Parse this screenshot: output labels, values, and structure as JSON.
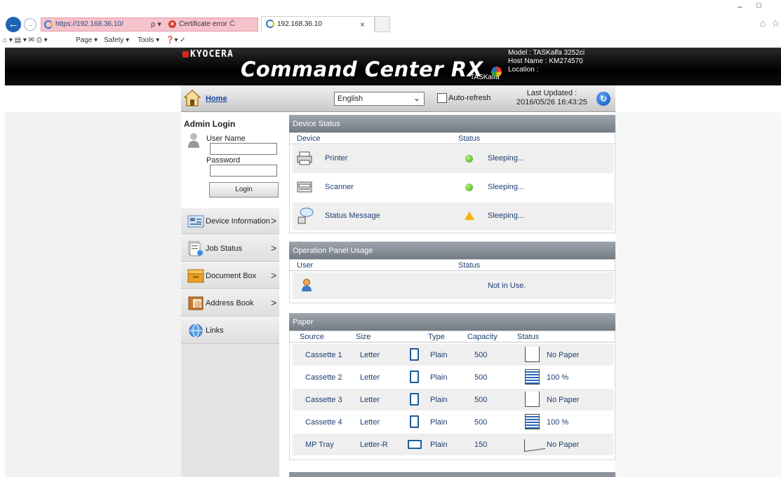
{
  "browser": {
    "url": "https://192.168.36.10/",
    "search_glyph": "ρ ▾",
    "cert_error": "Certificate error",
    "refresh_glyph": "Ċ",
    "tab_title": "192.168.36.10",
    "tab_close": "×",
    "window_min": "–",
    "window_max": "□",
    "home_glyph": "⌂",
    "fav_glyph": "☆",
    "back_glyph": "←",
    "fwd_glyph": "→",
    "cmdbar": {
      "page": "Page ▾",
      "safety": "Safety ▾",
      "tools": "Tools ▾",
      "icons_left": "⌂ ▾  ▤ ▾ ✉  ⎙ ▾",
      "help": "❓▾  ✓"
    }
  },
  "header": {
    "brand": "KYOCERA",
    "product": "Command Center RX",
    "series": "TASKalfa",
    "model": "Model : TASKalfa 3252ci",
    "host": "Host Name : KM274570",
    "location": "Location :"
  },
  "navbar": {
    "home_label": "Home",
    "language": "English",
    "caret": "⌄",
    "auto_refresh": "Auto-refresh",
    "last_updated_label": "Last Updated :",
    "last_updated_value": "2016/05/26 16:43:25"
  },
  "sidebar": {
    "login_title": "Admin Login",
    "user_label": "User Name",
    "password_label": "Password",
    "login_button": "Login",
    "chev": ">",
    "items": [
      {
        "label": "Device Information",
        "icon": "device-info-icon"
      },
      {
        "label": "Job Status",
        "icon": "job-status-icon"
      },
      {
        "label": "Document Box",
        "icon": "document-box-icon"
      },
      {
        "label": "Address Book",
        "icon": "address-book-icon"
      },
      {
        "label": "Links",
        "icon": "links-icon"
      }
    ]
  },
  "device_status": {
    "title": "Device Status",
    "col_device": "Device",
    "col_status": "Status",
    "rows": [
      {
        "name": "Printer",
        "status": "Sleeping..."
      },
      {
        "name": "Scanner",
        "status": "Sleeping..."
      },
      {
        "name": "Status Message",
        "status": "Sleeping..."
      }
    ]
  },
  "panel_usage": {
    "title": "Operation Panel Usage",
    "col_user": "User",
    "col_status": "Status",
    "status": "Not in Use."
  },
  "paper": {
    "title": "Paper",
    "cols": {
      "source": "Source",
      "size": "Size",
      "type": "Type",
      "capacity": "Capacity",
      "status": "Status"
    },
    "rows": [
      {
        "source": "Cassette 1",
        "size": "Letter",
        "type": "Plain",
        "capacity": "500",
        "status": "No Paper"
      },
      {
        "source": "Cassette 2",
        "size": "Letter",
        "type": "Plain",
        "capacity": "500",
        "status": "100 %"
      },
      {
        "source": "Cassette 3",
        "size": "Letter",
        "type": "Plain",
        "capacity": "500",
        "status": "No Paper"
      },
      {
        "source": "Cassette 4",
        "size": "Letter",
        "type": "Plain",
        "capacity": "500",
        "status": "100 %"
      },
      {
        "source": "MP Tray",
        "size": "Letter-R",
        "type": "Plain",
        "capacity": "150",
        "status": "No Paper"
      }
    ]
  },
  "colors": {
    "accent": "#1646a6",
    "panel_header": "#838b94",
    "ok": "#43a01a",
    "warn": "#f4b400"
  }
}
